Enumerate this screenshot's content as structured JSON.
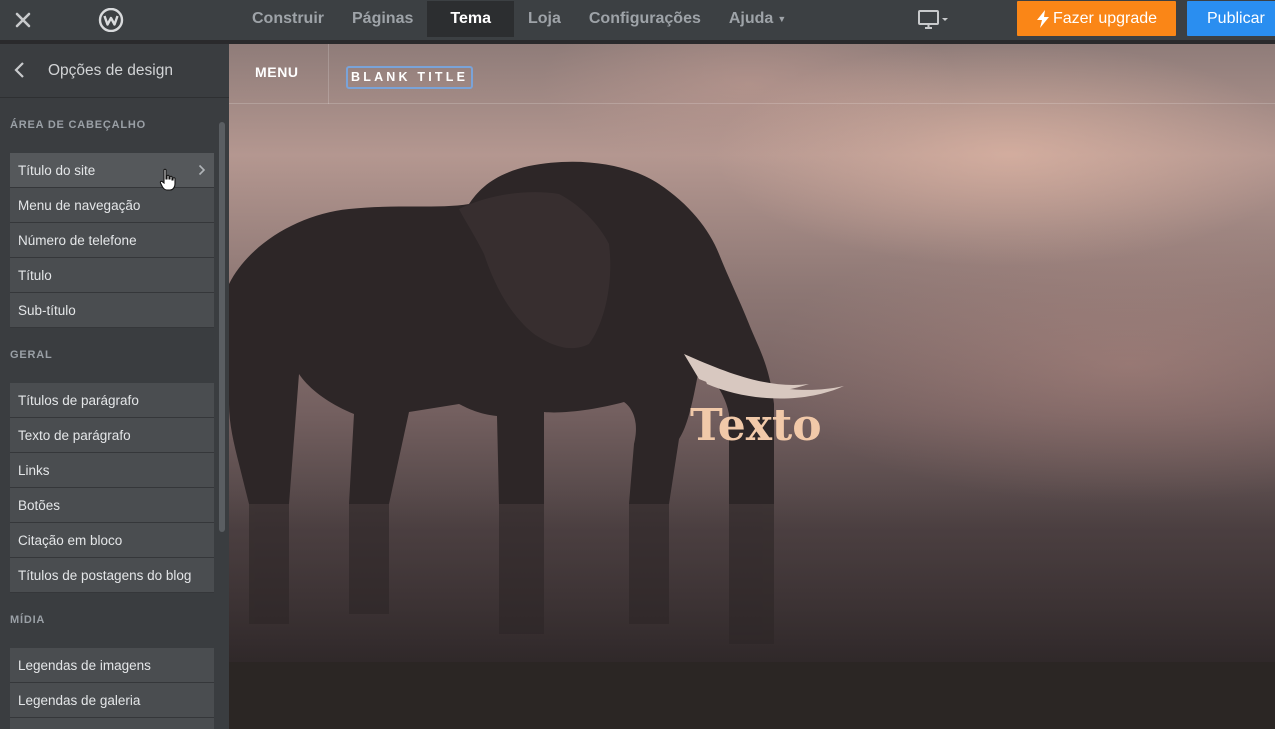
{
  "topbar": {
    "close_icon": "close-icon",
    "logo_icon": "weebly-logo-icon",
    "nav": [
      {
        "label": "Construir"
      },
      {
        "label": "Páginas"
      },
      {
        "label": "Tema"
      },
      {
        "label": "Loja"
      },
      {
        "label": "Configurações"
      },
      {
        "label": "Ajuda"
      }
    ],
    "active_nav": "Tema",
    "device_icon": "desktop-monitor-icon",
    "upgrade_label": "Fazer upgrade",
    "publish_label": "Publicar",
    "colors": {
      "bar": "#3c4043",
      "upgrade": "#fa8617",
      "publish": "#2a8ef0"
    }
  },
  "sidebar": {
    "title": "Opções de design",
    "sections": [
      {
        "label": "ÁREA DE CABEÇALHO",
        "items": [
          "Título do site",
          "Menu de navegação",
          "Número de telefone",
          "Título",
          "Sub-título"
        ]
      },
      {
        "label": "GERAL",
        "items": [
          "Títulos de parágrafo",
          "Texto de parágrafo",
          "Links",
          "Botões",
          "Citação em bloco",
          "Títulos de postagens do blog"
        ]
      },
      {
        "label": "MÍDIA",
        "items": [
          "Legendas de imagens",
          "Legendas de galeria"
        ]
      }
    ]
  },
  "canvas": {
    "menu_label": "MENU",
    "site_title": "BLANK TITLE",
    "hero_text": "Texto",
    "hero_text_color": "#f1c9a9"
  }
}
